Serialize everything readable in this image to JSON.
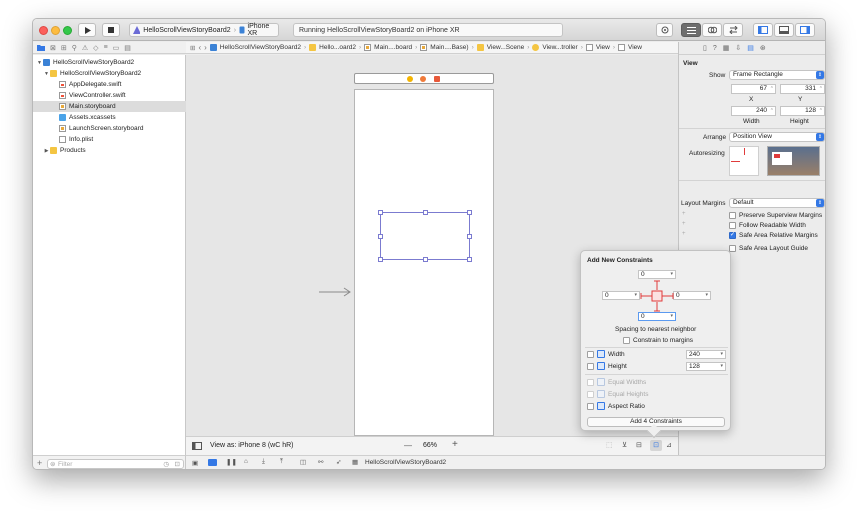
{
  "toolbar": {
    "scheme_target": "HelloScrollViewStoryBoard2",
    "scheme_device": "iPhone XR",
    "status_text": "Running HelloScrollViewStoryBoard2 on iPhone XR"
  },
  "jump_bar": {
    "crumbs": [
      "HelloScrollViewStoryBoard2",
      "Hello...oard2",
      "Main....board",
      "Main....Base)",
      "View...Scene",
      "View...troller",
      "View",
      "View"
    ]
  },
  "navigator": {
    "items": [
      {
        "label": "HelloScrollViewStoryBoard2",
        "icon": "project-icon"
      },
      {
        "label": "HelloScrollViewStoryBoard2",
        "icon": "folder-icon"
      },
      {
        "label": "AppDelegate.swift",
        "icon": "swift-file-icon"
      },
      {
        "label": "ViewController.swift",
        "icon": "swift-file-icon"
      },
      {
        "label": "Main.storyboard",
        "icon": "storyboard-icon",
        "selected": true
      },
      {
        "label": "Assets.xcassets",
        "icon": "asset-catalog-icon"
      },
      {
        "label": "LaunchScreen.storyboard",
        "icon": "storyboard-icon"
      },
      {
        "label": "Info.plist",
        "icon": "plist-icon"
      },
      {
        "label": "Products",
        "icon": "folder-icon"
      }
    ],
    "filter_placeholder": "Filter"
  },
  "canvas": {
    "view_as": "View as: iPhone 8 (wC hR)",
    "zoom_out": "—",
    "zoom": "66%",
    "zoom_in": "+"
  },
  "bottom_bar": {
    "target": "HelloScrollViewStoryBoard2"
  },
  "inspector": {
    "section": "View",
    "show_label": "Show",
    "show_value": "Frame Rectangle",
    "x": "67",
    "y": "331",
    "x_label": "X",
    "y_label": "Y",
    "width": "240",
    "height": "128",
    "width_label": "Width",
    "height_label": "Height",
    "arrange_label": "Arrange",
    "arrange_value": "Position View",
    "autoresizing_label": "Autoresizing",
    "layout_margins_label": "Layout Margins",
    "layout_margins_value": "Default",
    "preserve_superview": "Preserve Superview Margins",
    "follow_readable": "Follow Readable Width",
    "safe_area_relative": "Safe Area Relative Margins",
    "safe_area_guide": "Safe Area Layout Guide"
  },
  "constraints": {
    "title": "Add New Constraints",
    "top": "0",
    "left": "0",
    "right": "0",
    "bottom": "0",
    "spacing_label": "Spacing to nearest neighbor",
    "constrain_margins": "Constrain to margins",
    "width_label": "Width",
    "width_value": "240",
    "height_label": "Height",
    "height_value": "128",
    "equal_widths": "Equal Widths",
    "equal_heights": "Equal Heights",
    "aspect_ratio": "Aspect Ratio",
    "add_button": "Add 4 Constraints"
  },
  "colors": {
    "accent": "#3478e5",
    "strut_red": "#e03b3b",
    "selection_outline": "#7b7bd0"
  }
}
